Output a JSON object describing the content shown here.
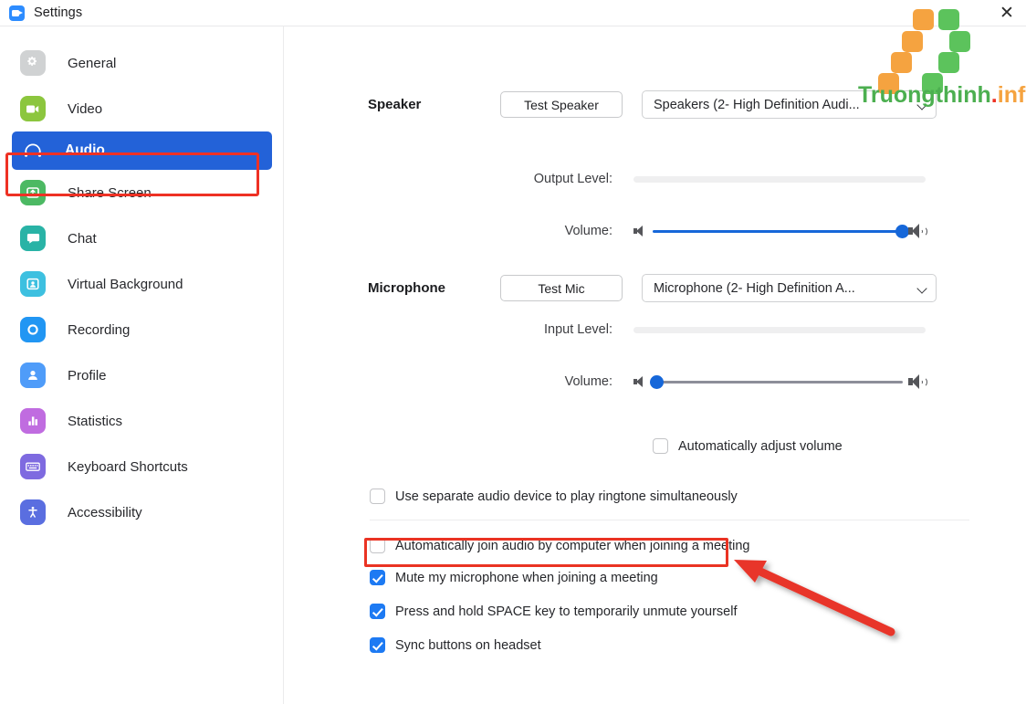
{
  "window": {
    "title": "Settings",
    "app_icon": "zoom-video-icon",
    "close_label": "✕"
  },
  "sidebar": {
    "items": [
      {
        "label": "General",
        "icon": "gear-icon",
        "color": "#d0d2d3",
        "active": false
      },
      {
        "label": "Video",
        "icon": "video-camera-icon",
        "color": "#8cc63e",
        "active": false
      },
      {
        "label": "Audio",
        "icon": "headphones-icon",
        "color": "#2362d8",
        "active": true
      },
      {
        "label": "Share Screen",
        "icon": "share-screen-icon",
        "color": "#4cb963",
        "active": false
      },
      {
        "label": "Chat",
        "icon": "chat-bubble-icon",
        "color": "#29b3a6",
        "active": false
      },
      {
        "label": "Virtual Background",
        "icon": "virtual-background-icon",
        "color": "#3dc0e0",
        "active": false
      },
      {
        "label": "Recording",
        "icon": "record-circle-icon",
        "color": "#2196f3",
        "active": false
      },
      {
        "label": "Profile",
        "icon": "person-icon",
        "color": "#4f9cf9",
        "active": false
      },
      {
        "label": "Statistics",
        "icon": "bar-chart-icon",
        "color": "#c06ce0",
        "active": false
      },
      {
        "label": "Keyboard Shortcuts",
        "icon": "keyboard-icon",
        "color": "#7e6ae0",
        "active": false
      },
      {
        "label": "Accessibility",
        "icon": "accessibility-icon",
        "color": "#5a6ee0",
        "active": false
      }
    ]
  },
  "speaker": {
    "section_label": "Speaker",
    "test_button": "Test Speaker",
    "device": "Speakers (2- High Definition Audi...",
    "output_level_label": "Output Level:",
    "output_level_value": 0,
    "volume_label": "Volume:",
    "volume_value": 100
  },
  "microphone": {
    "section_label": "Microphone",
    "test_button": "Test Mic",
    "device": "Microphone (2- High Definition A...",
    "input_level_label": "Input Level:",
    "input_level_value": 0,
    "volume_label": "Volume:",
    "volume_value": 2,
    "auto_adjust_label": "Automatically adjust volume",
    "auto_adjust_checked": false
  },
  "options": [
    {
      "label": "Use separate audio device to play ringtone simultaneously",
      "checked": false
    },
    {
      "label": "Automatically join audio by computer when joining a meeting",
      "checked": false
    },
    {
      "label": "Mute my microphone when joining a meeting",
      "checked": true
    },
    {
      "label": "Press and hold SPACE key to temporarily unmute yourself",
      "checked": true
    },
    {
      "label": "Sync buttons on headset",
      "checked": true
    }
  ],
  "annotations": {
    "highlight_color": "#ea3323",
    "arrow_color": "#e8362c",
    "highlighted_option": "Mute my microphone when joining a meeting",
    "highlighted_sidebar_item": "Audio"
  },
  "watermark": {
    "text_part1": "Truongthinh",
    "text_dot": ".",
    "text_part2": "info",
    "orange": "#f5a340",
    "green": "#5cc35c",
    "red": "#ee3124"
  }
}
